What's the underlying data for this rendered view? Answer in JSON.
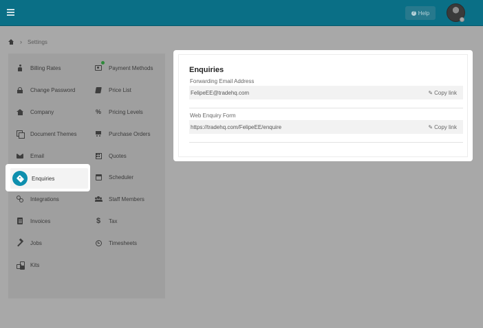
{
  "topbar": {
    "help_label": "Help",
    "accent_color": "#0a6f86"
  },
  "breadcrumb": {
    "current": "Settings"
  },
  "sidebar": {
    "left_column": [
      {
        "label": "Billing Rates",
        "icon": "person-icon"
      },
      {
        "label": "Change Password",
        "icon": "lock-icon"
      },
      {
        "label": "Company",
        "icon": "building-icon"
      },
      {
        "label": "Document Themes",
        "icon": "themes-icon"
      },
      {
        "label": "Email",
        "icon": "envelope-icon"
      },
      {
        "label": "Enquiries",
        "icon": "tag-icon"
      },
      {
        "label": "Integrations",
        "icon": "link-icon"
      },
      {
        "label": "Invoices",
        "icon": "document-icon"
      },
      {
        "label": "Jobs",
        "icon": "hammer-icon"
      },
      {
        "label": "Kits",
        "icon": "kits-icon"
      }
    ],
    "right_column": [
      {
        "label": "Payment Methods",
        "icon": "money-icon"
      },
      {
        "label": "Price List",
        "icon": "book-icon"
      },
      {
        "label": "Pricing Levels",
        "icon": "percent-icon"
      },
      {
        "label": "Purchase Orders",
        "icon": "cart-icon"
      },
      {
        "label": "Quotes",
        "icon": "calculator-icon"
      },
      {
        "label": "Scheduler",
        "icon": "calendar-icon"
      },
      {
        "label": "Staff Members",
        "icon": "users-icon"
      },
      {
        "label": "Tax",
        "icon": "dollar-icon"
      },
      {
        "label": "Timesheets",
        "icon": "clock-icon"
      }
    ],
    "selected": "Enquiries"
  },
  "enquiries": {
    "title": "Enquiries",
    "fields": [
      {
        "label": "Forwarding Email Address",
        "value": "FelipeEE@tradehq.com",
        "action": "Copy link"
      },
      {
        "label": "Web Enquiry Form",
        "value": "https://tradehq.com/FelipeEE/enquire",
        "action": "Copy link"
      }
    ]
  }
}
